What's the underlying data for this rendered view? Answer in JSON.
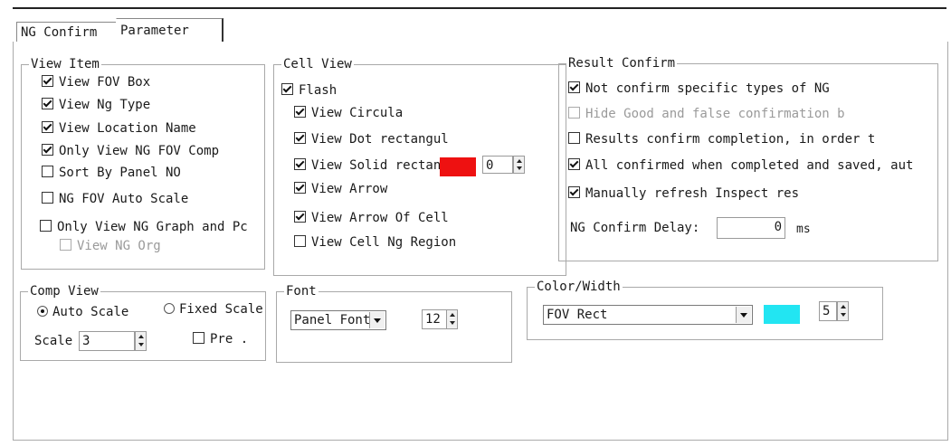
{
  "tabs": {
    "ng_confirm": "NG Confirm",
    "parameter": "Parameter"
  },
  "view_item": {
    "title": "View Item",
    "items": [
      {
        "label": "View FOV Box",
        "checked": true
      },
      {
        "label": "View Ng Type",
        "checked": true
      },
      {
        "label": "View Location Name",
        "checked": true
      },
      {
        "label": "Only View NG FOV Comp",
        "checked": true
      },
      {
        "label": "Sort By Panel NO",
        "checked": false
      },
      {
        "label": "NG FOV Auto Scale",
        "checked": false
      },
      {
        "label": "Only View NG Graph and Pc",
        "checked": false
      },
      {
        "label": "View NG Org",
        "checked": false,
        "disabled": true
      }
    ]
  },
  "cell_view": {
    "title": "Cell View",
    "flash": "Flash",
    "items": [
      {
        "label": "View Circula",
        "checked": true
      },
      {
        "label": "View Dot rectangul",
        "checked": true
      },
      {
        "label": "View Solid rectan",
        "checked": true
      },
      {
        "label": "View Arrow",
        "checked": true
      },
      {
        "label": "View Arrow Of Cell",
        "checked": true
      },
      {
        "label": "View Cell Ng Region",
        "checked": false
      }
    ],
    "solid_color": "#ee1111",
    "solid_value": "0"
  },
  "result_confirm": {
    "title": "Result Confirm",
    "items": [
      {
        "label": "Not confirm specific types of NG",
        "checked": true
      },
      {
        "label": "Hide Good and false confirmation b",
        "checked": false,
        "disabled": true
      },
      {
        "label": "Results confirm completion, in order t",
        "checked": false
      },
      {
        "label": "All confirmed when completed and saved, aut",
        "checked": true
      },
      {
        "label": "Manually refresh Inspect res",
        "checked": true
      }
    ],
    "delay_label": "NG Confirm Delay:",
    "delay_value": "0",
    "delay_unit": "ms"
  },
  "comp_view": {
    "title": "Comp View",
    "auto_scale": "Auto Scale",
    "fixed_scale": "Fixed Scale",
    "scale_label": "Scale",
    "scale_value": "3",
    "pre_label": "Pre ."
  },
  "font": {
    "title": "Font",
    "selected": "Panel Font",
    "size": "12"
  },
  "color_width": {
    "title": "Color/Width",
    "selected": "FOV Rect",
    "color": "#22e5f2",
    "width": "5"
  }
}
